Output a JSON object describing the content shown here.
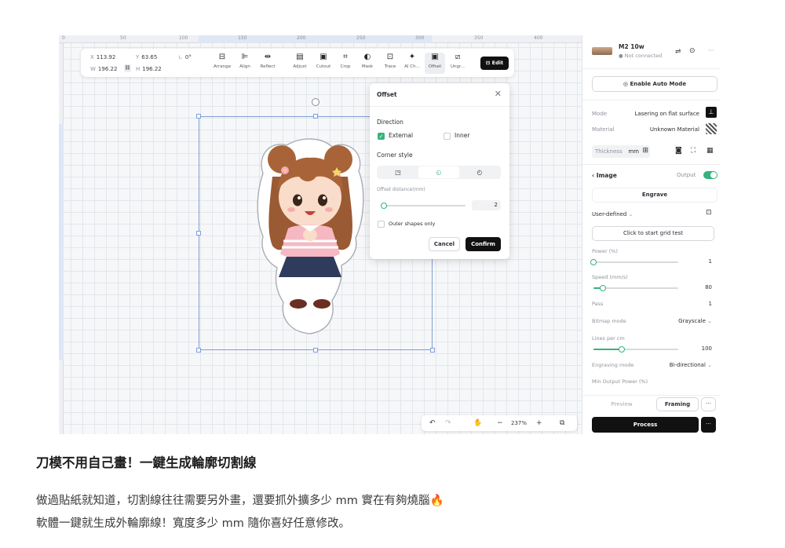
{
  "ruler": {
    "ticks": [
      "0",
      "50",
      "100",
      "150",
      "200",
      "250",
      "300",
      "350",
      "400"
    ]
  },
  "toolbar": {
    "x_label": "X",
    "x_value": "113.92",
    "y_label": "Y",
    "y_value": "63.65",
    "angle_value": "0°",
    "w_label": "W",
    "w_value": "196.22",
    "h_label": "H",
    "h_value": "196.22",
    "tools": [
      {
        "label": "Arrange",
        "icon": "arrange-icon",
        "glyph": "⊟"
      },
      {
        "label": "Align",
        "icon": "align-icon",
        "glyph": "⊫"
      },
      {
        "label": "Reflect",
        "icon": "reflect-icon",
        "glyph": "⇹"
      },
      {
        "label": "Adjust",
        "icon": "adjust-icon",
        "glyph": "▤"
      },
      {
        "label": "Cutout",
        "icon": "cutout-icon",
        "glyph": "▣"
      },
      {
        "label": "Crop",
        "icon": "crop-icon",
        "glyph": "⌗"
      },
      {
        "label": "Mask",
        "icon": "mask-icon",
        "glyph": "◐"
      },
      {
        "label": "Trace",
        "icon": "trace-icon",
        "glyph": "⊡"
      },
      {
        "label": "AI Ch...",
        "icon": "ai-icon",
        "glyph": "✦"
      },
      {
        "label": "Offset",
        "icon": "offset-icon",
        "glyph": "▣"
      },
      {
        "label": "Ungr...",
        "icon": "ungroup-icon",
        "glyph": "⧄"
      }
    ],
    "edit_label": "Edit"
  },
  "offset_panel": {
    "title": "Offset",
    "direction_label": "Direction",
    "external_label": "External",
    "external_checked": true,
    "inner_label": "Inner",
    "inner_checked": false,
    "corner_style_label": "Corner style",
    "corner_options": [
      "◳",
      "◵",
      "◴"
    ],
    "corner_selected": 1,
    "distance_label": "Offset distance(mm)",
    "distance_value": "2",
    "outer_shapes_label": "Outer shapes only",
    "cancel_label": "Cancel",
    "confirm_label": "Confirm"
  },
  "bottom_bar": {
    "zoom": "237%"
  },
  "panel": {
    "device_name": "M2 10w",
    "device_status": "Not connected",
    "auto_mode_label": "Enable Auto Mode",
    "mode_label": "Mode",
    "mode_value": "Lasering on flat surface",
    "material_label": "Material",
    "material_value": "Unknown Material",
    "thickness_label": "Thickness",
    "thickness_unit": "mm",
    "image_label": "Image",
    "output_label": "Output",
    "output_on": true,
    "engrave_label": "Engrave",
    "preset_value": "User-defined",
    "grid_test_label": "Click to start grid test",
    "power_label": "Power (%)",
    "power_value": "1",
    "power_fraction": 0.01,
    "speed_label": "Speed (mm/s)",
    "speed_value": "80",
    "pass_label": "Pass",
    "pass_value": "1",
    "bitmap_label": "Bitmap mode",
    "bitmap_value": "Grayscale",
    "lines_label": "Lines per cm",
    "lines_value": "100",
    "engraving_mode_label": "Engraving mode",
    "engraving_mode_value": "Bi-directional",
    "min_power_label": "Min Output Power (%)",
    "preview_label": "Preview",
    "framing_label": "Framing",
    "more_label": "···",
    "process_label": "Process"
  },
  "caption": {
    "title": "刀模不用自己畫！一鍵生成輪廓切割線",
    "line1": "做過貼紙就知道，切割線往往需要另外畫，還要抓外擴多少 mm 實在有夠燒腦🔥",
    "line2": "軟體一鍵就生成外輪廓線！寬度多少 mm 隨你喜好任意修改。"
  }
}
